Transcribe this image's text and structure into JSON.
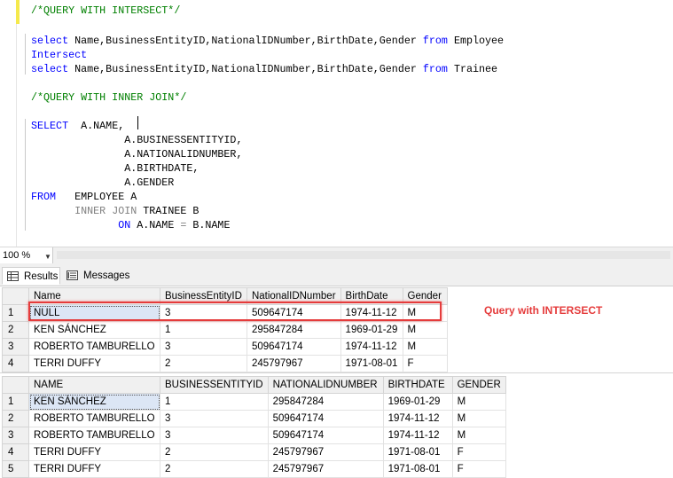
{
  "editor": {
    "lines": [
      {
        "segments": [
          {
            "t": "/*QUERY WITH INTERSECT*/",
            "c": "cm"
          }
        ]
      },
      {
        "segments": []
      },
      {
        "segments": [
          {
            "t": "select",
            "c": "kw"
          },
          {
            "t": " Name,BusinessEntityID,NationalIDNumber,BirthDate,Gender ",
            "c": ""
          },
          {
            "t": "from",
            "c": "kw"
          },
          {
            "t": " Employee",
            "c": ""
          }
        ]
      },
      {
        "segments": [
          {
            "t": "Intersect",
            "c": "kw"
          }
        ]
      },
      {
        "segments": [
          {
            "t": "select",
            "c": "kw"
          },
          {
            "t": " Name,BusinessEntityID,NationalIDNumber,BirthDate,Gender ",
            "c": ""
          },
          {
            "t": "from",
            "c": "kw"
          },
          {
            "t": " Trainee",
            "c": ""
          }
        ]
      },
      {
        "segments": []
      },
      {
        "segments": [
          {
            "t": "/*QUERY WITH INNER JOIN*/",
            "c": "cm"
          }
        ]
      },
      {
        "segments": []
      },
      {
        "segments": [
          {
            "t": "SELECT",
            "c": "kw"
          },
          {
            "t": "  A.NAME,",
            "c": ""
          }
        ]
      },
      {
        "segments": [
          {
            "t": "               A.BUSINESSENTITYID,",
            "c": ""
          }
        ]
      },
      {
        "segments": [
          {
            "t": "               A.NATIONALIDNUMBER,",
            "c": ""
          }
        ]
      },
      {
        "segments": [
          {
            "t": "               A.BIRTHDATE,",
            "c": ""
          }
        ]
      },
      {
        "segments": [
          {
            "t": "               A.GENDER",
            "c": ""
          }
        ]
      },
      {
        "segments": [
          {
            "t": "FROM",
            "c": "kw"
          },
          {
            "t": "   EMPLOYEE A",
            "c": ""
          }
        ]
      },
      {
        "segments": [
          {
            "t": "       ",
            "c": ""
          },
          {
            "t": "INNER JOIN",
            "c": "gr"
          },
          {
            "t": " TRAINEE B",
            "c": ""
          }
        ]
      },
      {
        "segments": [
          {
            "t": "              ",
            "c": ""
          },
          {
            "t": "ON",
            "c": "kw"
          },
          {
            "t": " A.NAME ",
            "c": ""
          },
          {
            "t": "=",
            "c": "gr"
          },
          {
            "t": " B.NAME",
            "c": ""
          }
        ]
      }
    ]
  },
  "statusbar": {
    "zoom": "100 %"
  },
  "tabs": [
    {
      "label": "Results",
      "active": true
    },
    {
      "label": "Messages",
      "active": false
    }
  ],
  "results1": {
    "columns": [
      "Name",
      "BusinessEntityID",
      "NationalIDNumber",
      "BirthDate",
      "Gender"
    ],
    "rows": [
      [
        "1",
        "NULL",
        "3",
        "509647174",
        "1974-11-12",
        "M"
      ],
      [
        "2",
        "KEN SÁNCHEZ",
        "1",
        "295847284",
        "1969-01-29",
        "M"
      ],
      [
        "3",
        "ROBERTO TAMBURELLO",
        "3",
        "509647174",
        "1974-11-12",
        "M"
      ],
      [
        "4",
        "TERRI DUFFY",
        "2",
        "245797967",
        "1971-08-01",
        "F"
      ]
    ]
  },
  "results2": {
    "columns": [
      "NAME",
      "BUSINESSENTITYID",
      "NATIONALIDNUMBER",
      "BIRTHDATE",
      "GENDER"
    ],
    "rows": [
      [
        "1",
        "KEN SÁNCHEZ",
        "1",
        "295847284",
        "1969-01-29",
        "M"
      ],
      [
        "2",
        "ROBERTO TAMBURELLO",
        "3",
        "509647174",
        "1974-11-12",
        "M"
      ],
      [
        "3",
        "ROBERTO TAMBURELLO",
        "3",
        "509647174",
        "1974-11-12",
        "M"
      ],
      [
        "4",
        "TERRI DUFFY",
        "2",
        "245797967",
        "1971-08-01",
        "F"
      ],
      [
        "5",
        "TERRI DUFFY",
        "2",
        "245797967",
        "1971-08-01",
        "F"
      ]
    ]
  },
  "annotation": {
    "text": "Query with INTERSECT",
    "color": "#e53b3b"
  }
}
